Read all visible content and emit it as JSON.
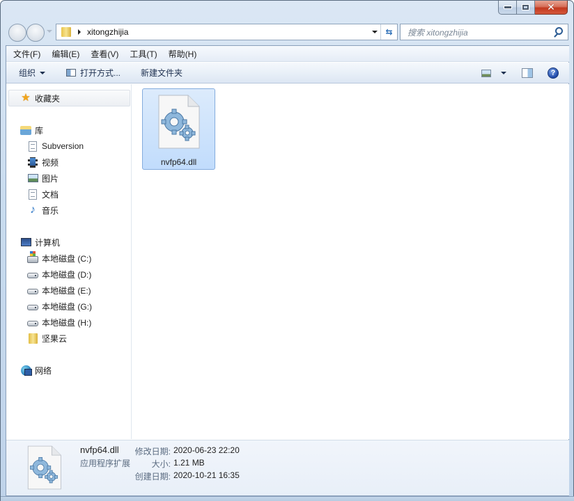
{
  "window": {
    "caption_buttons": {
      "minimize": "minimize",
      "maximize": "maximize",
      "close": "✕"
    }
  },
  "address_bar": {
    "path_segments": [
      "xitongzhijia"
    ],
    "separator_icon": "breadcrumb-arrow",
    "refresh_icon": "⇆"
  },
  "search": {
    "placeholder": "搜索 xitongzhijia"
  },
  "menubar": {
    "items": [
      {
        "label": "文件(F)"
      },
      {
        "label": "编辑(E)"
      },
      {
        "label": "查看(V)"
      },
      {
        "label": "工具(T)"
      },
      {
        "label": "帮助(H)"
      }
    ]
  },
  "commandbar": {
    "organize": "组织",
    "open_with": "打开方式...",
    "new_folder": "新建文件夹",
    "help_glyph": "?"
  },
  "navpane": {
    "favorites": {
      "label": "收藏夹",
      "icon": "★"
    },
    "libraries": {
      "label": "库",
      "items": [
        {
          "label": "Subversion"
        },
        {
          "label": "视频"
        },
        {
          "label": "图片"
        },
        {
          "label": "文档"
        },
        {
          "label": "音乐",
          "icon": "♪"
        }
      ]
    },
    "computer": {
      "label": "计算机",
      "items": [
        {
          "label": "本地磁盘 (C:)"
        },
        {
          "label": "本地磁盘 (D:)"
        },
        {
          "label": "本地磁盘 (E:)"
        },
        {
          "label": "本地磁盘 (G:)"
        },
        {
          "label": "本地磁盘 (H:)"
        },
        {
          "label": "坚果云"
        }
      ]
    },
    "network": {
      "label": "网络"
    }
  },
  "content": {
    "files": [
      {
        "name": "nvfp64.dll",
        "selected": true
      }
    ]
  },
  "details": {
    "name": "nvfp64.dll",
    "type": "应用程序扩展",
    "modified_label": "修改日期:",
    "modified_value": "2020-06-23 22:20",
    "size_label": "大小:",
    "size_value": "1.21 MB",
    "created_label": "创建日期:",
    "created_value": "2020-10-21 16:35"
  }
}
